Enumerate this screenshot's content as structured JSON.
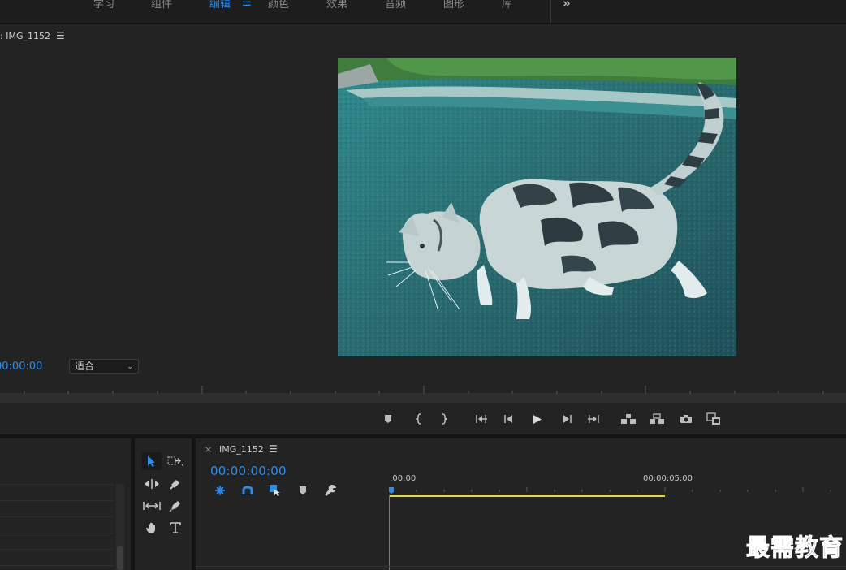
{
  "workspace_tabs": [
    {
      "label": "学习",
      "active": false
    },
    {
      "label": "组件",
      "active": false
    },
    {
      "label": "编辑",
      "active": true
    },
    {
      "label": "颜色",
      "active": false
    },
    {
      "label": "效果",
      "active": false
    },
    {
      "label": "音频",
      "active": false
    },
    {
      "label": "图形",
      "active": false
    },
    {
      "label": "库",
      "active": false
    }
  ],
  "workspace_menu_icon": "hamburger-icon",
  "workspace_overflow": "»",
  "program_monitor": {
    "title": ": IMG_1152",
    "menu_icon": "hamburger-icon",
    "timecode": "00:00:00",
    "fit_label": "适合"
  },
  "transport_buttons": [
    "add-marker-icon",
    "mark-in-icon",
    "mark-out-icon",
    "go-to-in-icon",
    "step-back-icon",
    "play-icon",
    "step-forward-icon",
    "go-to-out-icon",
    "lift-icon",
    "extract-icon",
    "export-frame-icon",
    "compare-view-icon"
  ],
  "tools_panel": [
    "selection-tool-icon",
    "track-select-forward-icon",
    "ripple-edit-icon",
    "razor-icon",
    "slip-icon",
    "pen-icon",
    "hand-icon",
    "type-tool-icon"
  ],
  "timeline": {
    "close": "×",
    "title": "IMG_1152",
    "menu_icon": "hamburger-icon",
    "timecode": "00:00:00:00",
    "ruler_start": ":00:00",
    "ruler_mark": "00:00:05:00",
    "tool_icons": [
      "nest-icon",
      "snap-magnet-icon",
      "linked-selection-icon",
      "add-marker-icon",
      "wrench-icon"
    ]
  },
  "watermark": "最需教育",
  "colors": {
    "accent_blue": "#2d8ceb",
    "work_area_yellow": "#e8d833",
    "panel_bg": "#232323"
  }
}
